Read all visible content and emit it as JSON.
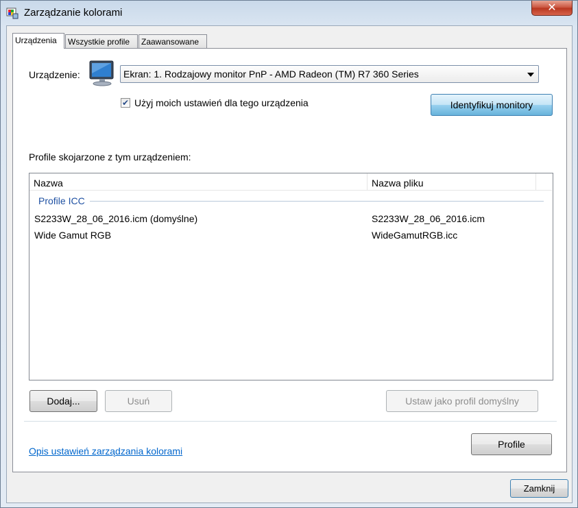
{
  "window": {
    "title": "Zarządzanie kolorami",
    "close_symbol": "✕"
  },
  "tabs": [
    {
      "label": "Urządzenia",
      "active": true
    },
    {
      "label": "Wszystkie profile",
      "active": false
    },
    {
      "label": "Zaawansowane",
      "active": false
    }
  ],
  "device": {
    "label": "Urządzenie:",
    "selected": "Ekran: 1. Rodzajowy monitor PnP - AMD Radeon (TM) R7 360 Series",
    "use_settings_label": "Użyj moich ustawień dla tego urządzenia",
    "use_settings_checked": true,
    "checkmark": "✔",
    "identify_button": "Identyfikuj monitory",
    "icon": "monitor-icon"
  },
  "profiles": {
    "section_label": "Profile skojarzone z tym urządzeniem:",
    "columns": [
      "Nazwa",
      "Nazwa pliku"
    ],
    "group": "Profile ICC",
    "rows": [
      {
        "name": "S2233W_28_06_2016.icm (domyślne)",
        "file": "S2233W_28_06_2016.icm"
      },
      {
        "name": "Wide Gamut RGB",
        "file": "WideGamutRGB.icc"
      }
    ]
  },
  "buttons": {
    "add": "Dodaj...",
    "remove": "Usuń",
    "set_default": "Ustaw jako profil domyślny",
    "profiles": "Profile",
    "close": "Zamknij"
  },
  "link": "Opis ustawień zarządzania kolorami",
  "colors": {
    "accent": "#0066cc",
    "group_label": "#1e50a2",
    "close_button": "#c9503a"
  }
}
